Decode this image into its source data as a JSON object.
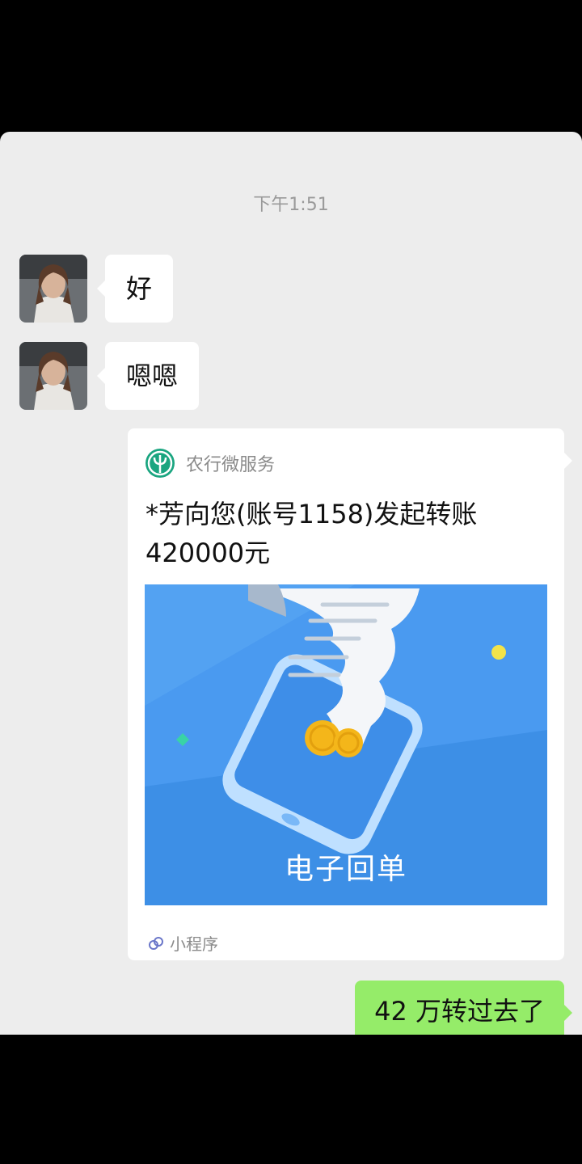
{
  "chat": {
    "timestamp": "下午1:51",
    "messages": [
      {
        "sender": "contact",
        "text": "好"
      },
      {
        "sender": "contact",
        "text": "嗯嗯"
      }
    ],
    "card": {
      "source": "农行微服务",
      "title": "*芳向您(账号1158)发起转账420000元",
      "image_label": "电子回单",
      "footer": "小程序",
      "logo_icon": "abc-bank-icon",
      "colors": {
        "logo": "#1aa580",
        "banner": "#4a9af0"
      }
    },
    "reply": {
      "sender": "me",
      "text": "42 万转过去了"
    }
  },
  "colors": {
    "chat_bg": "#ededed",
    "incoming_bubble": "#ffffff",
    "outgoing_bubble": "#95ec69",
    "timestamp": "#9a9a9a"
  }
}
